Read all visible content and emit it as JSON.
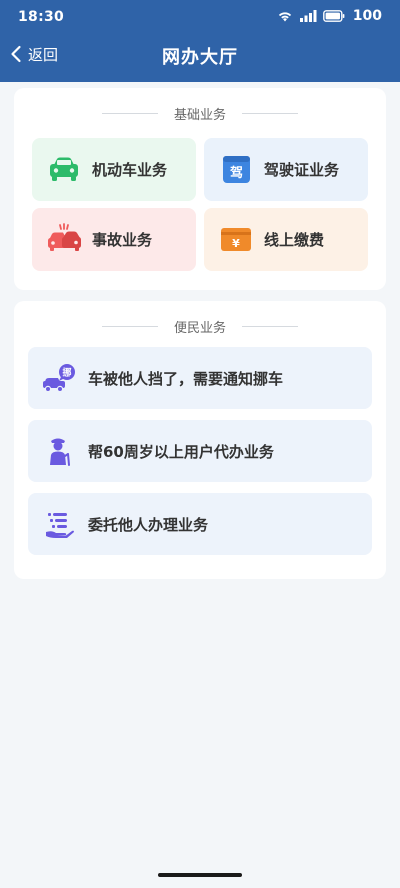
{
  "status_bar": {
    "time": "18:30",
    "battery": "100",
    "icons": [
      "wifi-icon",
      "signal-icon",
      "battery-icon"
    ]
  },
  "nav": {
    "back_label": "返回",
    "title": "网办大厅"
  },
  "basic_services": {
    "title": "基础业务",
    "items": [
      {
        "label": "机动车业务",
        "icon": "car-icon",
        "color": "#2dbb6a"
      },
      {
        "label": "驾驶证业务",
        "icon": "license-icon",
        "color": "#3d85e0",
        "badge": "驾"
      },
      {
        "label": "事故业务",
        "icon": "accident-car-icon",
        "color": "#ef5b5b"
      },
      {
        "label": "线上缴费",
        "icon": "payment-icon",
        "color": "#f08a2a",
        "badge": "¥"
      }
    ]
  },
  "convenience_services": {
    "title": "便民业务",
    "items": [
      {
        "label": "车被他人挡了，需要通知挪车",
        "icon": "move-car-icon",
        "badge": "挪",
        "color": "#6a5ae0"
      },
      {
        "label": "帮60周岁以上用户代办业务",
        "icon": "elderly-icon",
        "color": "#6a5ae0"
      },
      {
        "label": "委托他人办理业务",
        "icon": "entrust-list-icon",
        "color": "#6a5ae0"
      }
    ]
  },
  "colors": {
    "header": "#2f63a8",
    "background": "#f3f6f9",
    "accent_purple": "#6a5ae0"
  }
}
